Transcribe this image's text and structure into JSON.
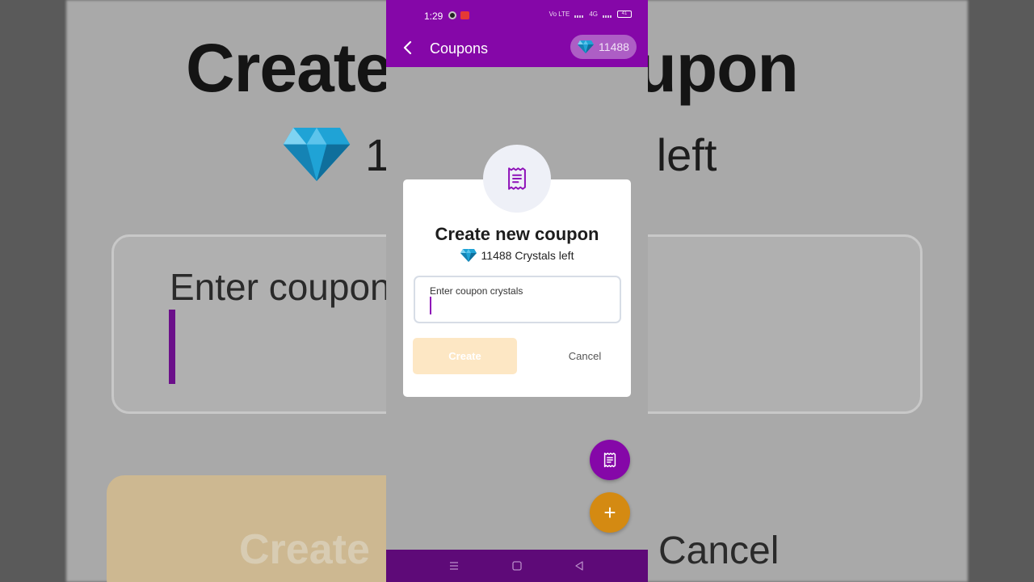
{
  "background": {
    "title": "Create new coupon",
    "subtitle_prefix": "1",
    "subtitle_suffix": "s left",
    "field_label": "Enter coupon",
    "create_label": "Create",
    "cancel_label": "Cancel"
  },
  "statusbar": {
    "time": "1:29",
    "network_label": "Vo LTE",
    "signal_label": "4G",
    "battery": "41"
  },
  "appbar": {
    "title": "Coupons",
    "crystal_count": "11488",
    "back_icon": "back-arrow-icon",
    "crystal_icon": "diamond-icon"
  },
  "dialog": {
    "badge_icon": "receipt-icon",
    "title": "Create new coupon",
    "crystals_left": "11488 Crystals left",
    "input_label": "Enter coupon crystals",
    "input_value": "",
    "create_label": "Create",
    "cancel_label": "Cancel"
  },
  "fabs": {
    "coupons_icon": "receipt-icon",
    "add_icon": "plus-icon",
    "add_symbol": "+"
  },
  "colors": {
    "primary": "#8507a8",
    "accent": "#d48a12",
    "create_disabled": "#fde7c4"
  }
}
